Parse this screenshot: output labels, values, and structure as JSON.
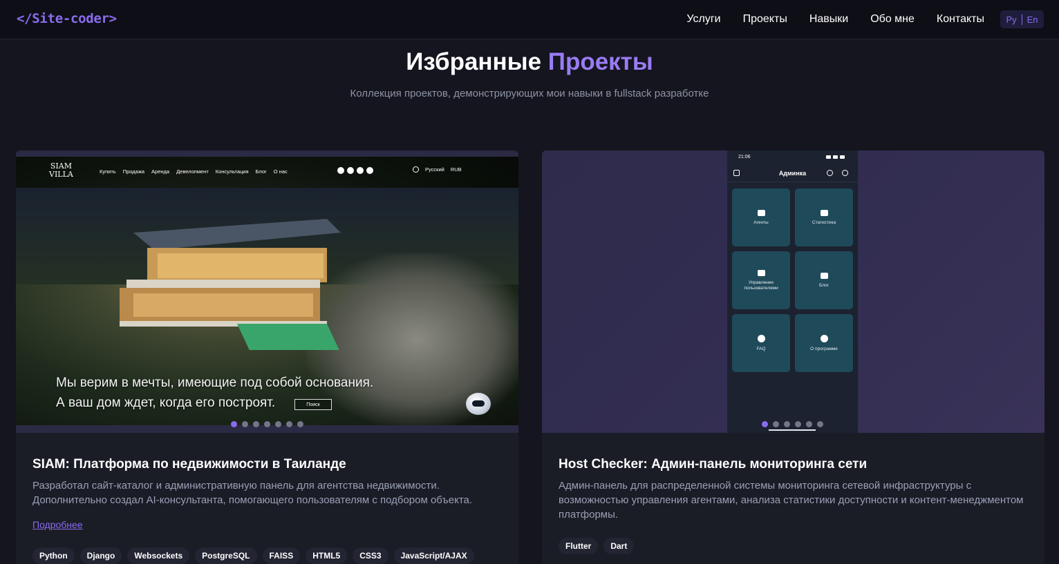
{
  "header": {
    "logo": "</Site-coder>",
    "nav": [
      "Услуги",
      "Проекты",
      "Навыки",
      "Обо мне",
      "Контакты"
    ],
    "lang_active": "Ру",
    "lang_other": "En"
  },
  "section": {
    "title_main": "Избранные",
    "title_accent": "Проекты",
    "subtitle": "Коллекция проектов, демонстрирующих мои навыки в fullstack разработке"
  },
  "colors": {
    "accent": "#8b6cf0",
    "background": "#14151e",
    "card": "#1a1c26"
  },
  "projects": [
    {
      "title": "SIAM: Платформа по недвижимости в Таиланде",
      "description": "Разработал сайт-каталог и административную панель для агентства недвижимости. Дополнительно создал AI-консультанта, помогающего пользователям с подбором объекта.",
      "link": "Подробнее",
      "tags": [
        "Python",
        "Django",
        "Websockets",
        "PostgreSQL",
        "FAISS",
        "HTML5",
        "CSS3",
        "JavaScript/AJAX"
      ],
      "slides": 7,
      "active_slide": 1,
      "preview": {
        "logo_line1": "SIAM",
        "logo_line2": "VILLA",
        "nav": [
          "Купить",
          "Продажа",
          "Аренда",
          "Девелопмент",
          "Консультация",
          "Блог",
          "О нас"
        ],
        "language": "Русский",
        "currency": "RUB",
        "caption_line1": "Мы верим в мечты, имеющие под собой основания.",
        "caption_line2": "А ваш дом ждет, когда его построят.",
        "button": "Поиск"
      }
    },
    {
      "title": "Host Checker: Админ-панель мониторинга сети",
      "description": "Админ-панель для распределенной системы мониторинга сетевой инфраструктуры с возможностью управления агентами, анализа статистики доступности и контент-менеджментом платформы.",
      "tags": [
        "Flutter",
        "Dart"
      ],
      "slides": 6,
      "active_slide": 1,
      "preview": {
        "time": "21:06",
        "app_title": "Админка",
        "tiles": [
          {
            "label": "Агенты",
            "icon": "laptop-icon"
          },
          {
            "label": "Статистика",
            "icon": "chart-icon"
          },
          {
            "label": "Управление пользователями",
            "icon": "users-icon"
          },
          {
            "label": "Блог",
            "icon": "document-icon"
          },
          {
            "label": "FAQ",
            "icon": "help-icon"
          },
          {
            "label": "О программе",
            "icon": "info-icon"
          }
        ]
      }
    }
  ]
}
